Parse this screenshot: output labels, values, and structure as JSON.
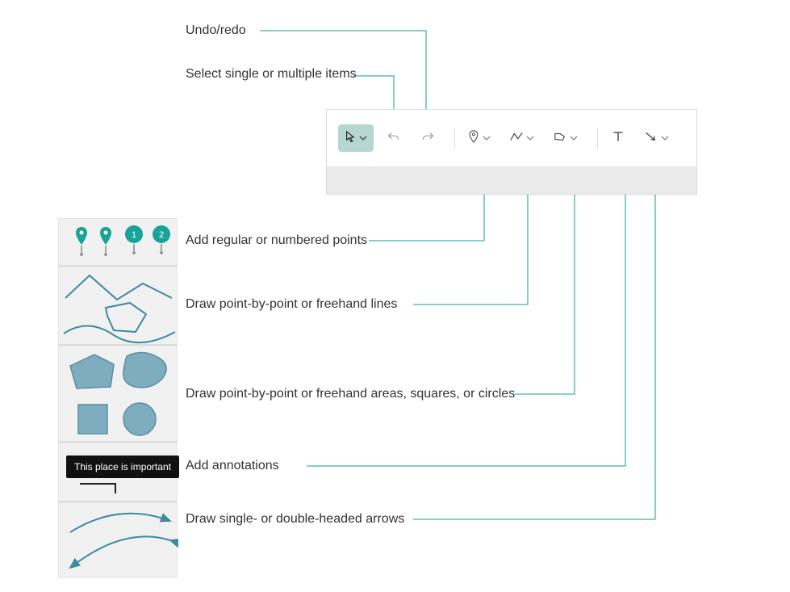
{
  "labels": {
    "undo_redo": "Undo/redo",
    "select": "Select single or multiple items",
    "points": "Add regular or numbered points",
    "lines": "Draw point-by-point or freehand lines",
    "areas": "Draw point-by-point or freehand areas, squares, or circles",
    "annotations": "Add annotations",
    "arrows": "Draw single- or double-headed arrows"
  },
  "toolbar": {
    "select_tool": "Select",
    "undo_tool": "Undo",
    "redo_tool": "Redo",
    "point_tool": "Point",
    "line_tool": "Line",
    "shape_tool": "Shape",
    "text_tool": "Text",
    "arrow_tool": "Arrow"
  },
  "example_tooltip": "This place is important",
  "example_badges": {
    "badge1": "1",
    "badge2": "2"
  },
  "colors": {
    "accent": "#149a90",
    "fill_blue": "#7fadc0",
    "fill_teal": "#17a398"
  }
}
